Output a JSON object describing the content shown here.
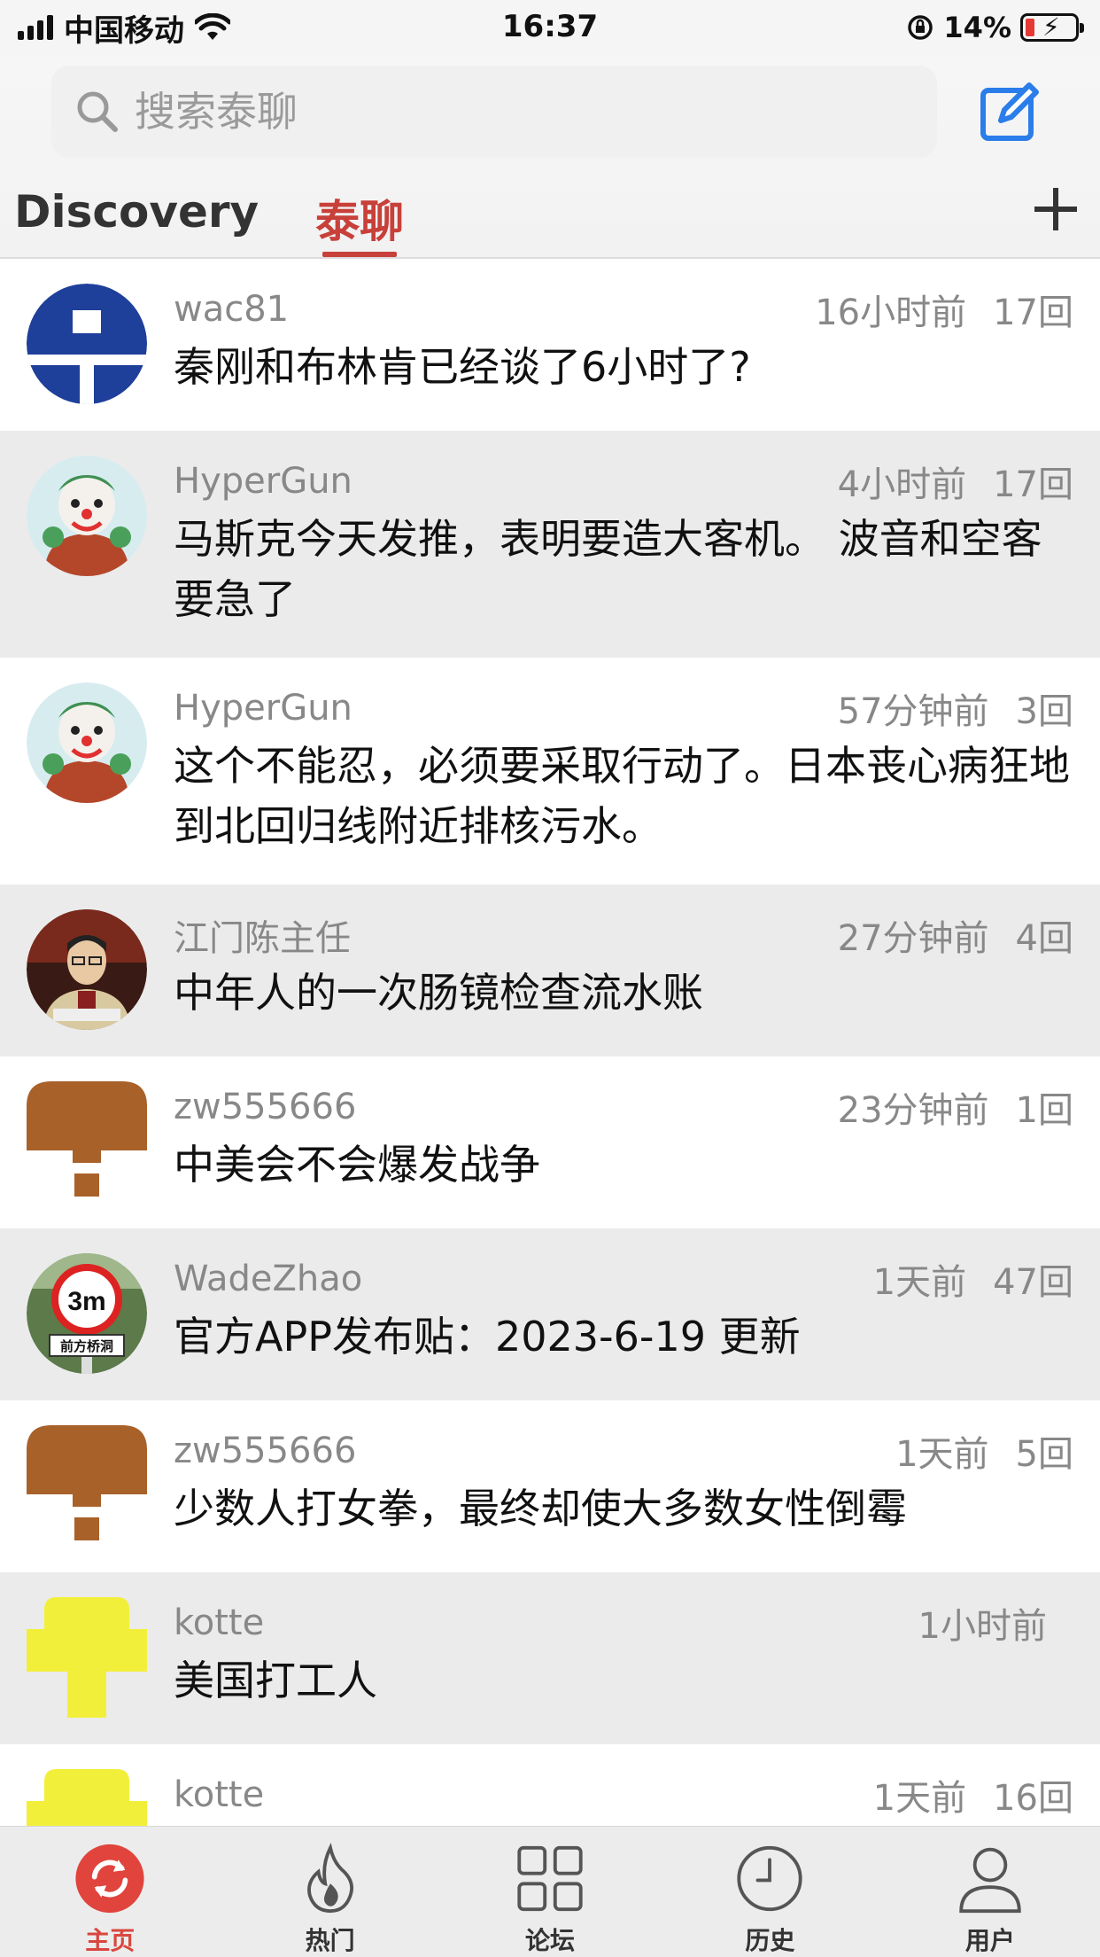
{
  "status_bar": {
    "carrier": "中国移动",
    "time": "16:37",
    "battery_percent": "14%"
  },
  "header": {
    "search_placeholder": "搜索泰聊",
    "tabs": [
      {
        "label": "Discovery",
        "active": false
      },
      {
        "label": "泰聊",
        "active": true
      }
    ]
  },
  "colors": {
    "accent": "#c8403a",
    "compose_icon": "#2b7de9",
    "row_alt_bg": "#ebebeb"
  },
  "posts": [
    {
      "user": "wac81",
      "time": "16小时前",
      "replies": "17回",
      "title": "秦刚和布林肯已经谈了6小时了?",
      "avatar": "blue-logo-avatar"
    },
    {
      "user": "HyperGun",
      "time": "4小时前",
      "replies": "17回",
      "title": "马斯克今天发推，表明要造大客机。 波音和空客要急了",
      "avatar": "joker-avatar"
    },
    {
      "user": "HyperGun",
      "time": "57分钟前",
      "replies": "3回",
      "title": "这个不能忍，必须要采取行动了。日本丧心病狂地到北回归线附近排核污水。",
      "avatar": "joker-avatar"
    },
    {
      "user": "江门陈主任",
      "time": "27分钟前",
      "replies": "4回",
      "title": "中年人的一次肠镜检查流水账",
      "avatar": "portrait-avatar"
    },
    {
      "user": "zw555666",
      "time": "23分钟前",
      "replies": "1回",
      "title": "中美会不会爆发战争",
      "avatar": "brown-pixel-avatar"
    },
    {
      "user": "WadeZhao",
      "time": "1天前",
      "replies": "47回",
      "title": "官方APP发布贴：2023-6-19 更新",
      "avatar": "road-sign-avatar",
      "sign_text": "3m",
      "sign_sub": "前方桥洞"
    },
    {
      "user": "zw555666",
      "time": "1天前",
      "replies": "5回",
      "title": "少数人打女拳，最终却使大多数女性倒霉",
      "avatar": "brown-pixel-avatar"
    },
    {
      "user": "kotte",
      "time": "1小时前",
      "replies": "",
      "title": "美国打工人",
      "avatar": "yellow-pixel-avatar"
    },
    {
      "user": "kotte",
      "time": "1天前",
      "replies": "16回",
      "title": "",
      "avatar": "yellow-pixel-avatar"
    }
  ],
  "tabbar": [
    {
      "label": "主页",
      "icon": "refresh-icon",
      "active": true
    },
    {
      "label": "热门",
      "icon": "flame-icon",
      "active": false
    },
    {
      "label": "论坛",
      "icon": "grid-icon",
      "active": false
    },
    {
      "label": "历史",
      "icon": "clock-icon",
      "active": false
    },
    {
      "label": "用户",
      "icon": "user-icon",
      "active": false
    }
  ]
}
